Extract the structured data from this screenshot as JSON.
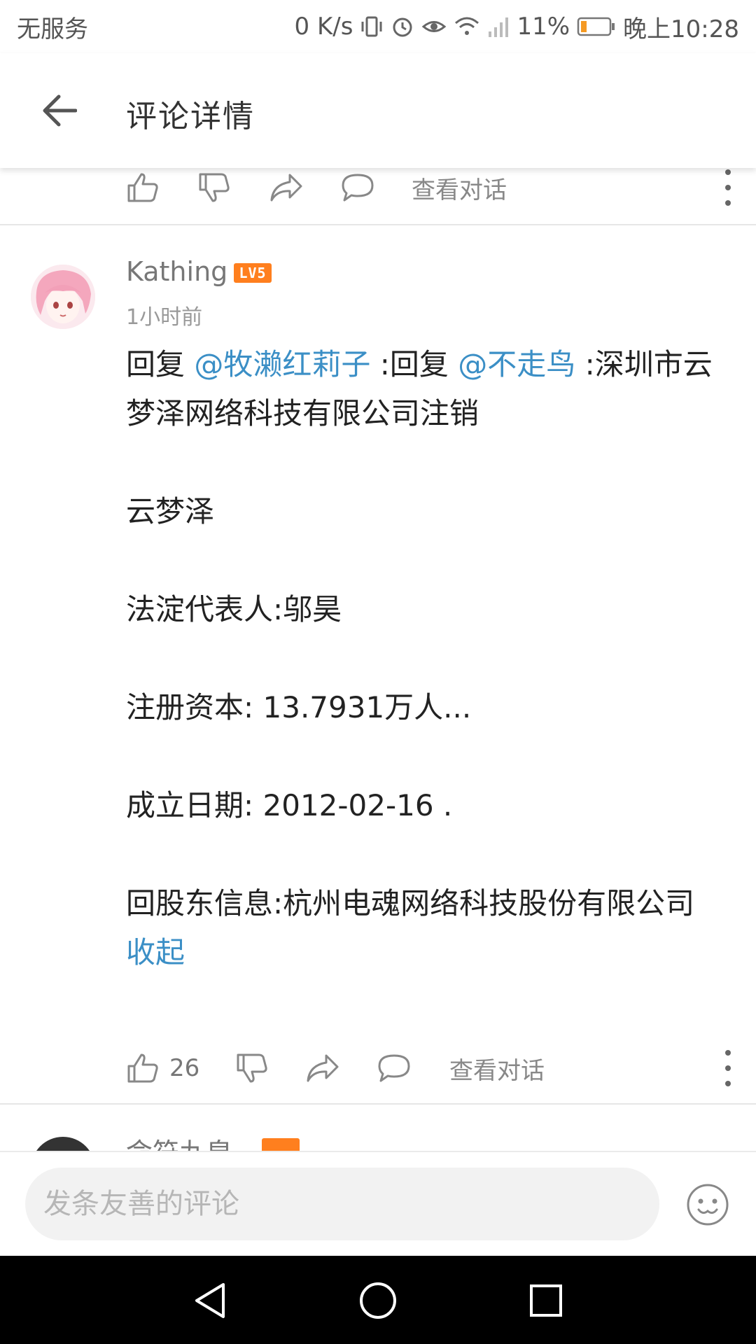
{
  "status_bar": {
    "carrier": "无服务",
    "net_speed": "0 K/s",
    "battery_percent": "11%",
    "time": "晚上10:28"
  },
  "header": {
    "title": "评论详情"
  },
  "prev_comment_actions": {
    "view_dialog_label": "查看对话"
  },
  "comment": {
    "username": "Kathing",
    "level": "LV5",
    "time": "1小时前",
    "reply_prefix_1": "回复 ",
    "mention_1": "@牧濑红莉子",
    "reply_prefix_2": " :回复 ",
    "mention_2": "@不走鸟",
    "line1_rest": " :深圳市云梦泽网络科技有限公司注销",
    "line2": "云梦泽",
    "line3": "法淀代表人:邬昊",
    "line4": "注册资本: 13.7931万人...",
    "line5": "成立日期: 2012-02-16 .",
    "line6": "回股东信息:杭州电魂网络科技股份有限公司",
    "collapse_label": "收起",
    "like_count": "26",
    "view_dialog_label": "查看对话"
  },
  "next_comment": {
    "username_partial": "命符九皇"
  },
  "input_bar": {
    "placeholder": "发条友善的评论"
  },
  "colors": {
    "mention": "#3b8fc6",
    "level_badge": "#ff7f1e",
    "battery_low": "#f59a23"
  }
}
